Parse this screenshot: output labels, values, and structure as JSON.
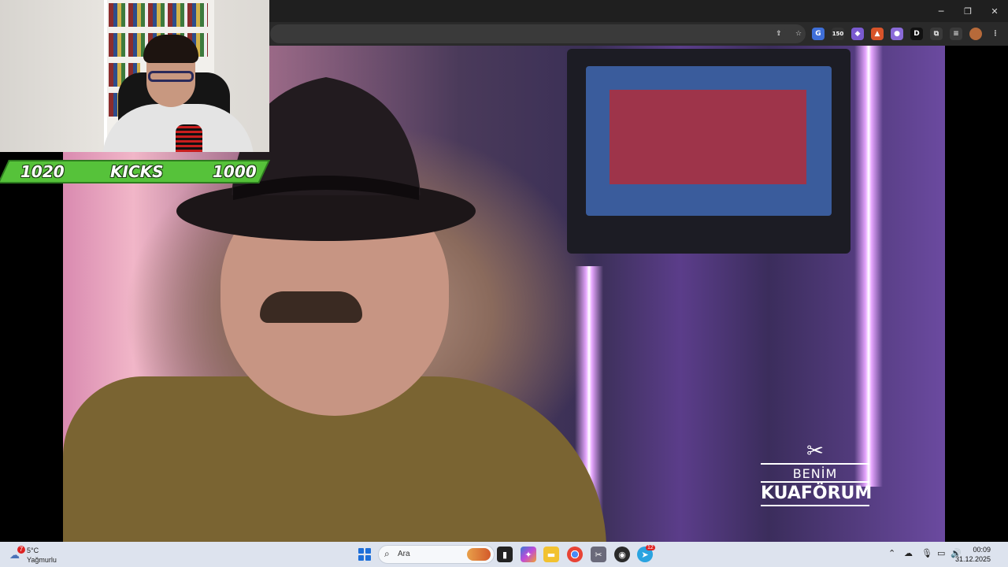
{
  "score": {
    "left": "1020",
    "center": "KICKS",
    "right": "1000",
    "bar_color": "#56c23a"
  },
  "window_controls": {
    "minimize": "─",
    "restore": "❐",
    "close": "✕"
  },
  "extensions": {
    "badge_count": "150",
    "d_label": "D"
  },
  "video_logo": {
    "line1": "BENİM",
    "line2": "KUAFÖRUM",
    "icon": "scissors-icon"
  },
  "taskbar": {
    "weather_badge": "7",
    "weather_temp": "5°C",
    "weather_desc": "Yağmurlu",
    "search_placeholder": "Ara",
    "time": "00:09",
    "date": "31.12.2025",
    "telegram_badge": "12",
    "accent": "#1e6fd9"
  }
}
